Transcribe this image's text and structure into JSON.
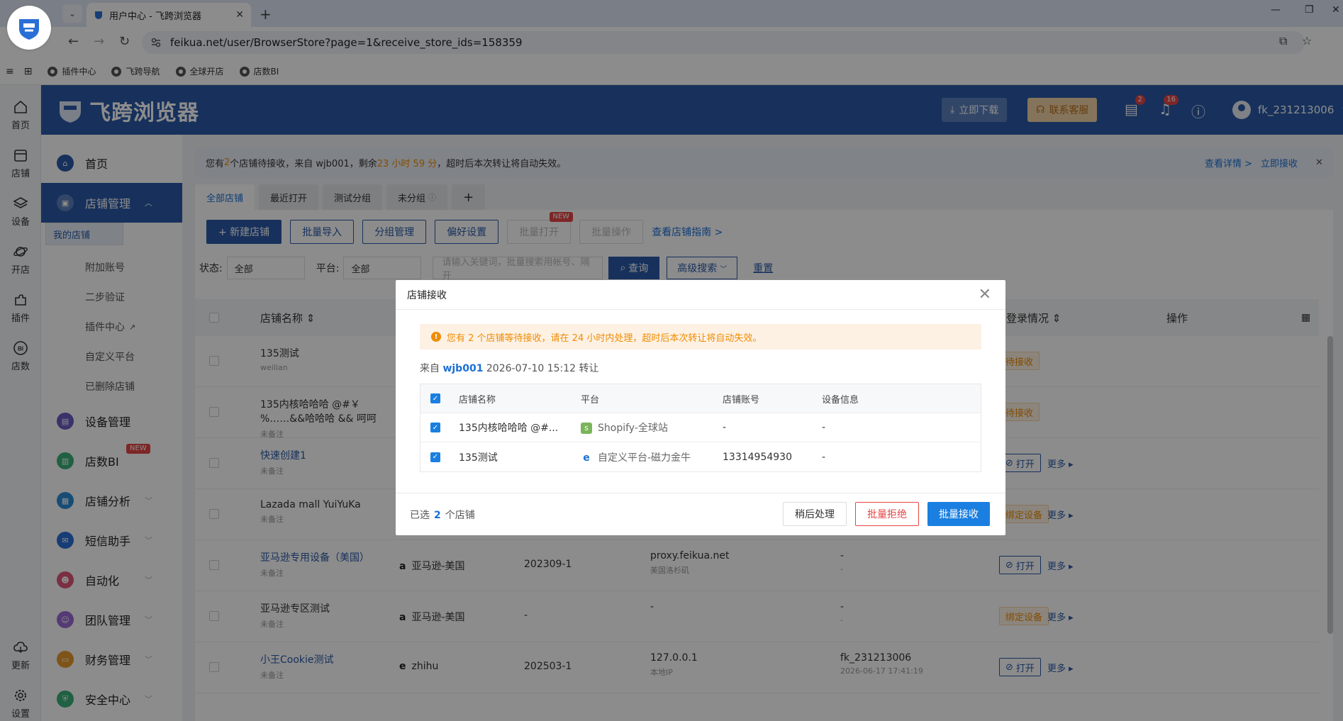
{
  "browser": {
    "tab_title": "用户中心 - 飞跨浏览器",
    "url": "feikua.net/user/BrowserStore?page=1&receive_store_ids=158359",
    "bookmarks": [
      "插件中心",
      "飞跨导航",
      "全球开店",
      "店数BI"
    ]
  },
  "rail": [
    {
      "label": "首页",
      "icon": "home-icon"
    },
    {
      "label": "店铺",
      "icon": "store-icon"
    },
    {
      "label": "设备",
      "icon": "layers-icon"
    },
    {
      "label": "开店",
      "icon": "planet-icon"
    },
    {
      "label": "插件",
      "icon": "puzzle-icon"
    },
    {
      "label": "店数",
      "icon": "bi-icon"
    },
    {
      "label": "更新",
      "icon": "cloud-icon"
    },
    {
      "label": "设置",
      "icon": "gear-icon"
    }
  ],
  "header": {
    "brand": "飞跨浏览器",
    "download": "立即下载",
    "support": "联系客服",
    "msg_badge": "2",
    "bell_badge": "16",
    "username": "fk_231213006"
  },
  "sidenav": {
    "home": "首页",
    "store_mgmt": "店铺管理",
    "subs": [
      "我的店铺",
      "附加账号",
      "二步验证",
      "插件中心",
      "自定义平台",
      "已删除店铺"
    ],
    "device_mgmt": "设备管理",
    "bi": "店数BI",
    "bi_badge": "NEW",
    "store_analysis": "店铺分析",
    "sms": "短信助手",
    "automation": "自动化",
    "team": "团队管理",
    "finance": "财务管理",
    "security": "安全中心"
  },
  "notice": {
    "p1": "您有 ",
    "count": "2",
    "p2": " 个店铺待接收，来自 wjb001，剩余",
    "remain": "23 小时 59 分",
    "p3": "，超时后本次转让将自动失效。",
    "view": "查看详情 >",
    "receive": "立即接收"
  },
  "tabs": [
    "全部店铺",
    "最近打开",
    "测试分组",
    "未分组"
  ],
  "toolbar": {
    "new_store": "+ 新建店铺",
    "batch_import": "批量导入",
    "group_mgmt": "分组管理",
    "prefs": "偏好设置",
    "batch_open": "批量打开",
    "new_tag": "NEW",
    "batch_ops": "批量操作",
    "guide": "查看店铺指南 >"
  },
  "filters": {
    "status_label": "状态:",
    "status_value": "全部",
    "platform_label": "平台:",
    "platform_value": "全部",
    "search_placeholder": "请输入关键词，批量搜索用帐号、隔开",
    "query": "查询",
    "advanced": "高级搜索",
    "reset": "重置"
  },
  "table": {
    "col_name": "店铺名称 ⇕",
    "col_login": "登录情况 ⇕",
    "col_ops": "操作",
    "rows": [
      {
        "name": "135测试",
        "sub": "weilian",
        "platform": "",
        "account": "",
        "proxy": "",
        "proxy_sub": "",
        "login": "",
        "login_sub": "",
        "action": "待接收",
        "more": ""
      },
      {
        "name": "135内核哈哈哈 @#￥%……&&哈哈哈 && 呵呵",
        "sub": "未备注",
        "platform": "",
        "account": "",
        "proxy": "",
        "proxy_sub": "",
        "login": "",
        "login_sub": "",
        "action": "待接收",
        "more": ""
      },
      {
        "name": "快速创建1",
        "sub": "未备注",
        "platform": "",
        "account": "",
        "proxy": "",
        "proxy_sub": "",
        "login": "",
        "login_sub": "",
        "action": "打开",
        "more": "更多 ▸"
      },
      {
        "name": "Lazada mall YuiYuKa",
        "sub": "未备注",
        "platform": "",
        "account": "",
        "proxy": "",
        "proxy_sub": "",
        "login": "",
        "login_sub": "",
        "action": "绑定设备",
        "more": "更多 ▸"
      },
      {
        "name": "亚马逊专用设备（美国）",
        "sub": "未备注",
        "platform": "亚马逊-美国",
        "account": "202309-1",
        "proxy": "proxy.feikua.net",
        "proxy_sub": "美国洛杉矶",
        "login": "-",
        "login_sub": "-",
        "action": "打开",
        "more": "更多 ▸"
      },
      {
        "name": "亚马逊专区测试",
        "sub": "未备注",
        "platform": "亚马逊-美国",
        "account": "-",
        "proxy": "-",
        "proxy_sub": "",
        "login": "-",
        "login_sub": "-",
        "action": "绑定设备",
        "more": "更多 ▸"
      },
      {
        "name": "小王Cookie测试",
        "sub": "未备注",
        "platform": "zhihu",
        "account": "202503-1",
        "proxy": "127.0.0.1",
        "proxy_sub": "本地IP",
        "login": "fk_231213006",
        "login_sub": "2026-06-17 17:41:19",
        "action": "打开",
        "more": "更多 ▸"
      }
    ]
  },
  "modal": {
    "title": "店铺接收",
    "warning": "您有 2 个店铺等待接收，请在 24 小时内处理，超时后本次转让将自动失效。",
    "from_prefix": "来自",
    "from_user": "wjb001",
    "from_suffix": "2026-07-10 15:12 转让",
    "headers": [
      "店铺名称",
      "平台",
      "店铺账号",
      "设备信息"
    ],
    "rows": [
      {
        "name": "135内核哈哈哈 @#...",
        "platform": "Shopify-全球站",
        "account": "-",
        "device": "-"
      },
      {
        "name": "135测试",
        "platform": "自定义平台-磁力金牛",
        "account": "13314954930",
        "device": "-"
      }
    ],
    "selected_prefix": "已选",
    "selected_count": "2",
    "selected_suffix": "个店铺",
    "later": "稍后处理",
    "reject": "批量拒绝",
    "accept": "批量接收"
  },
  "colors": {
    "brand_blue": "#2a5aa8",
    "link_blue": "#1a6fd6",
    "warning_orange": "#f08c00",
    "danger_red": "#e64545"
  }
}
